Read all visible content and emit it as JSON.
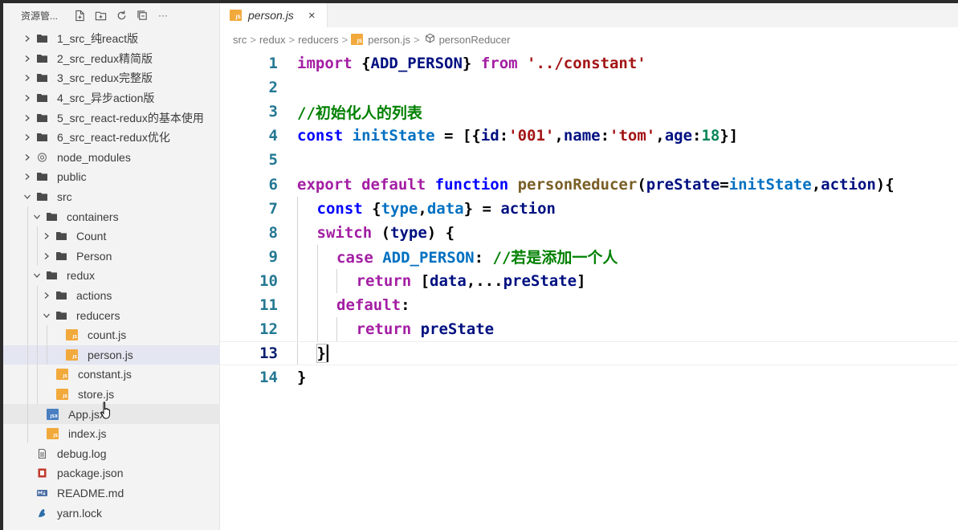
{
  "sidebar": {
    "title": "资源管...",
    "toolbar": [
      "new-file-icon",
      "new-folder-icon",
      "refresh-icon",
      "collapse-all-icon",
      "more-icon"
    ],
    "more_label": "···",
    "items": [
      {
        "label": "1_src_纯react版",
        "type": "folder",
        "depth": 0,
        "open": false
      },
      {
        "label": "2_src_redux精简版",
        "type": "folder",
        "depth": 0,
        "open": false
      },
      {
        "label": "3_src_redux完整版",
        "type": "folder",
        "depth": 0,
        "open": false
      },
      {
        "label": "4_src_异步action版",
        "type": "folder",
        "depth": 0,
        "open": false
      },
      {
        "label": "5_src_react-redux的基本使用",
        "type": "folder",
        "depth": 0,
        "open": false
      },
      {
        "label": "6_src_react-redux优化",
        "type": "folder",
        "depth": 0,
        "open": false
      },
      {
        "label": "node_modules",
        "type": "modules",
        "depth": 0,
        "open": false
      },
      {
        "label": "public",
        "type": "folder",
        "depth": 0,
        "open": false
      },
      {
        "label": "src",
        "type": "folder",
        "depth": 0,
        "open": true
      },
      {
        "label": "containers",
        "type": "folder",
        "depth": 1,
        "open": true
      },
      {
        "label": "Count",
        "type": "folder",
        "depth": 2,
        "open": false
      },
      {
        "label": "Person",
        "type": "folder",
        "depth": 2,
        "open": false
      },
      {
        "label": "redux",
        "type": "folder",
        "depth": 1,
        "open": true
      },
      {
        "label": "actions",
        "type": "folder",
        "depth": 2,
        "open": false
      },
      {
        "label": "reducers",
        "type": "folder",
        "depth": 2,
        "open": true
      },
      {
        "label": "count.js",
        "type": "js",
        "depth": 3
      },
      {
        "label": "person.js",
        "type": "js",
        "depth": 3,
        "selected": true
      },
      {
        "label": "constant.js",
        "type": "js",
        "depth": 2
      },
      {
        "label": "store.js",
        "type": "js",
        "depth": 2
      },
      {
        "label": "App.jsx",
        "type": "jsx",
        "depth": 1,
        "hover": true
      },
      {
        "label": "index.js",
        "type": "js",
        "depth": 1
      },
      {
        "label": "debug.log",
        "type": "log",
        "depth": 0
      },
      {
        "label": "package.json",
        "type": "json",
        "depth": 0
      },
      {
        "label": "README.md",
        "type": "md",
        "depth": 0
      },
      {
        "label": "yarn.lock",
        "type": "lock",
        "depth": 0
      }
    ]
  },
  "tab": {
    "name": "person.js",
    "close": "×",
    "badge": "JS"
  },
  "breadcrumb": [
    "src",
    "redux",
    "reducers",
    "person.js",
    "personReducer"
  ],
  "breadcrumb_sep": ">",
  "code": {
    "current_line": 13,
    "lines": [
      {
        "n": "1",
        "indent": 0,
        "tokens": [
          [
            "kw",
            "import"
          ],
          [
            "pl",
            " {"
          ],
          [
            "var",
            "ADD_PERSON"
          ],
          [
            "pl",
            "} "
          ],
          [
            "kw",
            "from"
          ],
          [
            "pl",
            " "
          ],
          [
            "str",
            "'../constant'"
          ]
        ]
      },
      {
        "n": "2",
        "indent": 0,
        "tokens": []
      },
      {
        "n": "3",
        "indent": 0,
        "tokens": [
          [
            "cm",
            "//初始化人的列表"
          ]
        ]
      },
      {
        "n": "4",
        "indent": 0,
        "tokens": [
          [
            "kw2",
            "const"
          ],
          [
            "pl",
            " "
          ],
          [
            "cst",
            "initState"
          ],
          [
            "pl",
            " = [{"
          ],
          [
            "var",
            "id"
          ],
          [
            "pl",
            ":"
          ],
          [
            "str",
            "'001'"
          ],
          [
            "pl",
            ","
          ],
          [
            "var",
            "name"
          ],
          [
            "pl",
            ":"
          ],
          [
            "str",
            "'tom'"
          ],
          [
            "pl",
            ","
          ],
          [
            "var",
            "age"
          ],
          [
            "pl",
            ":"
          ],
          [
            "num",
            "18"
          ],
          [
            "pl",
            "}]"
          ]
        ]
      },
      {
        "n": "5",
        "indent": 0,
        "tokens": []
      },
      {
        "n": "6",
        "indent": 0,
        "tokens": [
          [
            "kw",
            "export"
          ],
          [
            "pl",
            " "
          ],
          [
            "kw",
            "default"
          ],
          [
            "pl",
            " "
          ],
          [
            "kw2",
            "function"
          ],
          [
            "pl",
            " "
          ],
          [
            "fn",
            "personReducer"
          ],
          [
            "pl",
            "("
          ],
          [
            "var",
            "preState"
          ],
          [
            "pl",
            "="
          ],
          [
            "cst",
            "initState"
          ],
          [
            "pl",
            ","
          ],
          [
            "var",
            "action"
          ],
          [
            "pl",
            "){"
          ]
        ]
      },
      {
        "n": "7",
        "indent": 1,
        "tokens": [
          [
            "kw2",
            "const"
          ],
          [
            "pl",
            " {"
          ],
          [
            "cst",
            "type"
          ],
          [
            "pl",
            ","
          ],
          [
            "cst",
            "data"
          ],
          [
            "pl",
            "} = "
          ],
          [
            "var",
            "action"
          ]
        ]
      },
      {
        "n": "8",
        "indent": 1,
        "tokens": [
          [
            "kw",
            "switch"
          ],
          [
            "pl",
            " ("
          ],
          [
            "var",
            "type"
          ],
          [
            "pl",
            ") {"
          ]
        ]
      },
      {
        "n": "9",
        "indent": 2,
        "tokens": [
          [
            "kw",
            "case"
          ],
          [
            "pl",
            " "
          ],
          [
            "cst",
            "ADD_PERSON"
          ],
          [
            "pl",
            ": "
          ],
          [
            "cm",
            "//若是添加一个人"
          ]
        ]
      },
      {
        "n": "10",
        "indent": 3,
        "tokens": [
          [
            "kw",
            "return"
          ],
          [
            "pl",
            " ["
          ],
          [
            "var",
            "data"
          ],
          [
            "pl",
            ",..."
          ],
          [
            "var",
            "preState"
          ],
          [
            "pl",
            "]"
          ]
        ]
      },
      {
        "n": "11",
        "indent": 2,
        "tokens": [
          [
            "kw",
            "default"
          ],
          [
            "pl",
            ":"
          ]
        ]
      },
      {
        "n": "12",
        "indent": 3,
        "tokens": [
          [
            "kw",
            "return"
          ],
          [
            "pl",
            " "
          ],
          [
            "var",
            "preState"
          ]
        ]
      },
      {
        "n": "13",
        "indent": 1,
        "tokens": [
          [
            "pl",
            "}"
          ]
        ]
      },
      {
        "n": "14",
        "indent": 0,
        "tokens": [
          [
            "pl",
            "}"
          ]
        ]
      }
    ]
  },
  "colors": {
    "accent": "#0b216f",
    "js_badge": "#f2a93b",
    "jsx_badge": "#4a7fc1",
    "selection": "#e4e6f1"
  }
}
